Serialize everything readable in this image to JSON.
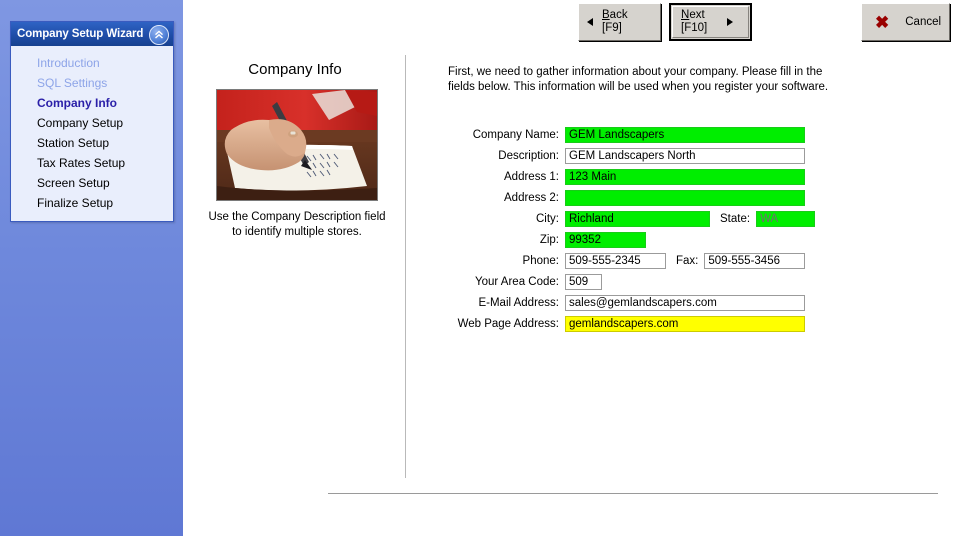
{
  "sidebar": {
    "title": "Company Setup Wizard",
    "collapse_icon": "chevron-double-up-icon",
    "items": [
      {
        "label": "Introduction",
        "state": "done"
      },
      {
        "label": "SQL Settings",
        "state": "done"
      },
      {
        "label": "Company Info",
        "state": "current"
      },
      {
        "label": "Company Setup",
        "state": "pending"
      },
      {
        "label": "Station Setup",
        "state": "pending"
      },
      {
        "label": "Tax Rates Setup",
        "state": "pending"
      },
      {
        "label": "Screen Setup",
        "state": "pending"
      },
      {
        "label": "Finalize Setup",
        "state": "pending"
      }
    ]
  },
  "toolbar": {
    "back_label": "Back",
    "back_key": "[F9]",
    "back_icon": "arrow-left-icon",
    "next_label": "Next",
    "next_key": "[F10]",
    "next_icon": "arrow-right-icon",
    "cancel_label": "Cancel",
    "cancel_icon": "red-x-icon"
  },
  "page": {
    "title": "Company Info",
    "photo_alt": "hand-writing-on-notepad-photo",
    "photo_caption": "Use the Company Description field to identify multiple stores.",
    "intro": "First, we need to gather information about your company. Please fill in the fields below.  This information will be used when you register your software."
  },
  "form": {
    "company_name": {
      "label": "Company Name:",
      "value": "GEM Landscapers"
    },
    "description": {
      "label": "Description:",
      "value": "GEM Landscapers North"
    },
    "address1": {
      "label": "Address 1:",
      "value": "123 Main"
    },
    "address2": {
      "label": "Address 2:",
      "value": ""
    },
    "city": {
      "label": "City:",
      "value": "Richland"
    },
    "state": {
      "label": "State:",
      "value": "WA"
    },
    "zip": {
      "label": "Zip:",
      "value": "99352"
    },
    "phone": {
      "label": "Phone:",
      "value": "509-555-2345"
    },
    "fax": {
      "label": "Fax:",
      "value": "509-555-3456"
    },
    "area_code": {
      "label": "Your Area Code:",
      "value": "509"
    },
    "email": {
      "label": "E-Mail Address:",
      "value": "sales@gemlandscapers.com"
    },
    "web": {
      "label": "Web Page Address:",
      "value": "gemlandscapers.com"
    }
  },
  "colors": {
    "highlight_green": "#00ee00",
    "highlight_yellow": "#ffff00",
    "sidebar_blue": "#6f89dc",
    "header_blue": "#1f4da8",
    "current_step": "#2a1fa8",
    "done_step": "#8da4e8",
    "cancel_x": "#990000"
  }
}
